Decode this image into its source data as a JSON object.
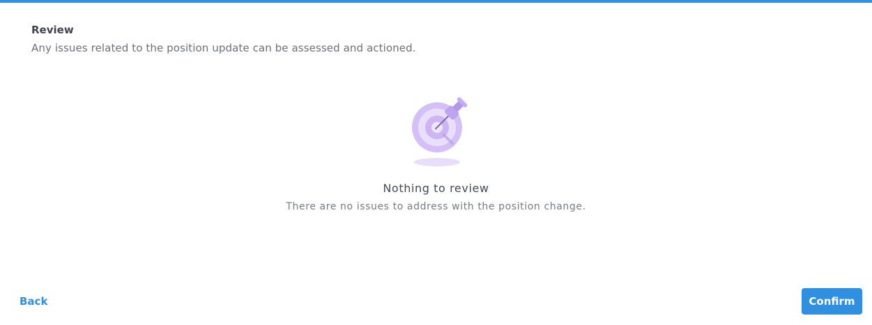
{
  "review": {
    "title": "Review",
    "subtitle": "Any issues related to the position update can be assessed and actioned."
  },
  "empty_state": {
    "icon": "pin-target-icon",
    "title": "Nothing to review",
    "text": "There are no issues to address with the position change."
  },
  "footer": {
    "back_label": "Back",
    "confirm_label": "Confirm"
  },
  "colors": {
    "accent": "#2f8fe0",
    "illustration": "#c9b2f2"
  }
}
